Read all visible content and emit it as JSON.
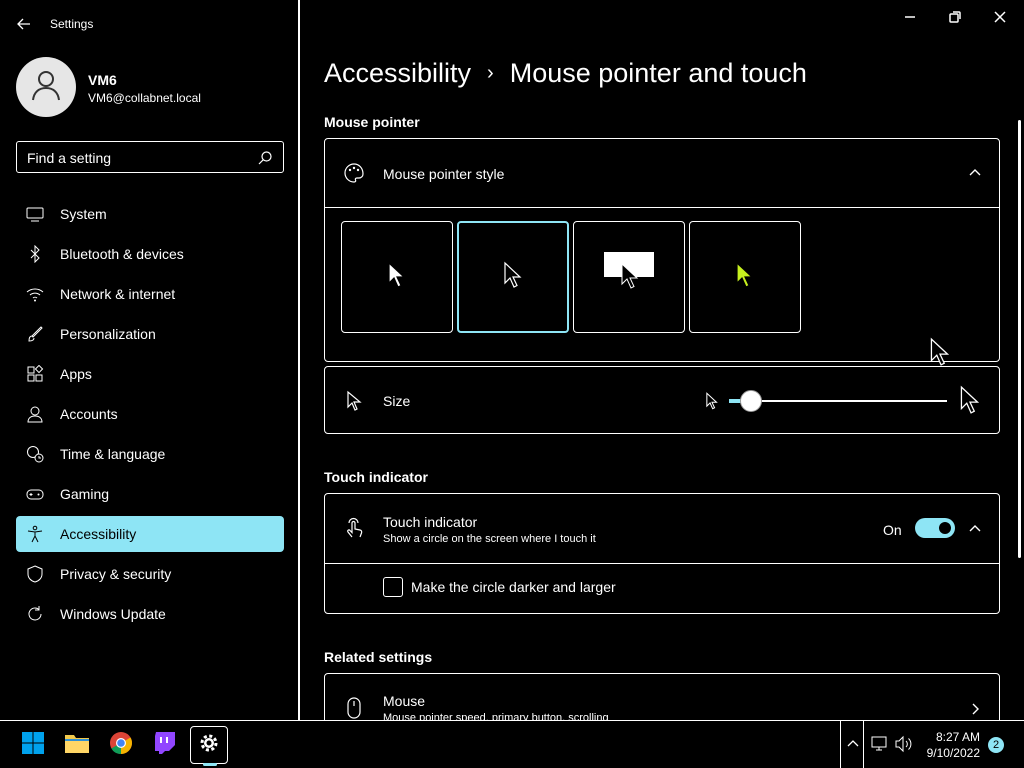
{
  "app": {
    "title": "Settings"
  },
  "user": {
    "name": "VM6",
    "email": "VM6@collabnet.local"
  },
  "search": {
    "placeholder": "Find a setting"
  },
  "sidebar": {
    "items": [
      {
        "label": "System",
        "icon": "monitor-icon"
      },
      {
        "label": "Bluetooth & devices",
        "icon": "bluetooth-icon"
      },
      {
        "label": "Network & internet",
        "icon": "wifi-icon"
      },
      {
        "label": "Personalization",
        "icon": "brush-icon"
      },
      {
        "label": "Apps",
        "icon": "apps-icon"
      },
      {
        "label": "Accounts",
        "icon": "person-icon"
      },
      {
        "label": "Time & language",
        "icon": "globe-clock-icon"
      },
      {
        "label": "Gaming",
        "icon": "gamepad-icon"
      },
      {
        "label": "Accessibility",
        "icon": "accessibility-icon",
        "active": true
      },
      {
        "label": "Privacy & security",
        "icon": "shield-icon"
      },
      {
        "label": "Windows Update",
        "icon": "update-icon"
      }
    ]
  },
  "breadcrumb": {
    "parent": "Accessibility",
    "separator": "›",
    "current": "Mouse pointer and touch"
  },
  "mouse_pointer": {
    "section_title": "Mouse pointer",
    "style_label": "Mouse pointer style",
    "styles": [
      {
        "name": "white",
        "selected": false
      },
      {
        "name": "black",
        "selected": true
      },
      {
        "name": "inverted",
        "selected": false
      },
      {
        "name": "custom",
        "selected": false,
        "color": "#c6f01e"
      }
    ],
    "size_label": "Size",
    "size_value": 0.1
  },
  "touch": {
    "section_title": "Touch indicator",
    "label": "Touch indicator",
    "description": "Show a circle on the screen where I touch it",
    "state": "On",
    "darker_label": "Make the circle darker and larger"
  },
  "related": {
    "section_title": "Related settings",
    "mouse_label": "Mouse",
    "mouse_description": "Mouse pointer speed, primary button, scrolling"
  },
  "taskbar": {
    "apps": [
      "start-icon",
      "file-explorer-icon",
      "chrome-icon",
      "twitch-icon",
      "settings-icon"
    ],
    "time": "8:27 AM",
    "date": "9/10/2022",
    "notifications": "2"
  },
  "colors": {
    "accent": "#8ee5f5",
    "background": "#000000",
    "foreground": "#ffffff"
  }
}
